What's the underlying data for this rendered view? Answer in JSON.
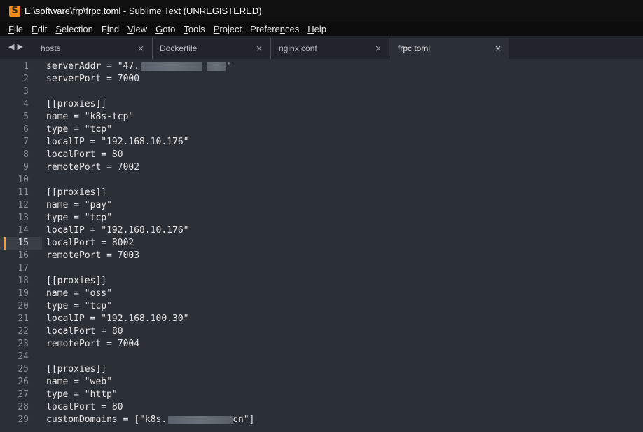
{
  "window": {
    "title": "E:\\software\\frp\\frpc.toml - Sublime Text (UNREGISTERED)",
    "app_icon": "S"
  },
  "menu": [
    {
      "mn": "F",
      "rest": "ile"
    },
    {
      "mn": "E",
      "rest": "dit"
    },
    {
      "mn": "S",
      "rest": "election"
    },
    {
      "pre": "F",
      "mn": "i",
      "rest": "nd"
    },
    {
      "mn": "V",
      "rest": "iew"
    },
    {
      "mn": "G",
      "rest": "oto"
    },
    {
      "mn": "T",
      "rest": "ools"
    },
    {
      "mn": "P",
      "rest": "roject"
    },
    {
      "pre": "Prefere",
      "mn": "n",
      "rest": "ces"
    },
    {
      "mn": "H",
      "rest": "elp"
    }
  ],
  "tabs": [
    {
      "label": "hosts",
      "close": "×"
    },
    {
      "label": "Dockerfile",
      "close": "×"
    },
    {
      "label": "nginx.conf",
      "close": "×"
    },
    {
      "label": "frpc.toml",
      "close": "×",
      "active": true
    }
  ],
  "tab_nav": "◀▶",
  "editor": {
    "current_line": 15,
    "lines": [
      {
        "n": "1",
        "a": "serverAddr = \"47.",
        "b": "\""
      },
      {
        "n": "2",
        "a": "serverPort = 7000"
      },
      {
        "n": "3",
        "a": ""
      },
      {
        "n": "4",
        "a": "[[proxies]]"
      },
      {
        "n": "5",
        "a": "name = \"k8s-tcp\""
      },
      {
        "n": "6",
        "a": "type = \"tcp\""
      },
      {
        "n": "7",
        "a": "localIP = \"192.168.10.176\""
      },
      {
        "n": "8",
        "a": "localPort = 80"
      },
      {
        "n": "9",
        "a": "remotePort = 7002"
      },
      {
        "n": "10",
        "a": ""
      },
      {
        "n": "11",
        "a": "[[proxies]]"
      },
      {
        "n": "12",
        "a": "name = \"pay\""
      },
      {
        "n": "13",
        "a": "type = \"tcp\""
      },
      {
        "n": "14",
        "a": "localIP = \"192.168.10.176\""
      },
      {
        "n": "15",
        "a": "localPort = 8002"
      },
      {
        "n": "16",
        "a": "remotePort = 7003"
      },
      {
        "n": "17",
        "a": ""
      },
      {
        "n": "18",
        "a": "[[proxies]]"
      },
      {
        "n": "19",
        "a": "name = \"oss\""
      },
      {
        "n": "20",
        "a": "type = \"tcp\""
      },
      {
        "n": "21",
        "a": "localIP = \"192.168.100.30\""
      },
      {
        "n": "22",
        "a": "localPort = 80"
      },
      {
        "n": "23",
        "a": "remotePort = 7004"
      },
      {
        "n": "24",
        "a": ""
      },
      {
        "n": "25",
        "a": "[[proxies]]"
      },
      {
        "n": "26",
        "a": "name = \"web\""
      },
      {
        "n": "27",
        "a": "type = \"http\""
      },
      {
        "n": "28",
        "a": "localPort = 80"
      },
      {
        "n": "29",
        "a": "customDomains = [\"k8s.",
        "b": "cn\"]"
      }
    ]
  },
  "colors": {
    "background": "#2b2f36",
    "tabbar": "#21252b",
    "titlebar": "#101010",
    "accent": "#f2a03c"
  }
}
